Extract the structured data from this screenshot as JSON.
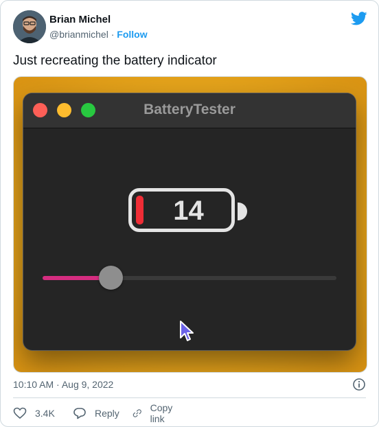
{
  "author": {
    "name": "Brian Michel",
    "handle": "@brianmichel",
    "separator": "·",
    "follow_label": "Follow"
  },
  "tweet": {
    "text": "Just recreating the battery indicator",
    "timestamp": "10:10 AM · Aug 9, 2022"
  },
  "app_window": {
    "title": "BatteryTester",
    "battery_level": "14",
    "slider_fraction": 0.14,
    "colors": {
      "close": "#fe5f57",
      "minimize": "#febc2e",
      "zoom": "#28c840",
      "battery_fill": "#ef2d36",
      "slider_fill": "#d52d80"
    }
  },
  "actions": {
    "like_count": "3.4K",
    "reply_label": "Reply",
    "copy_link_label": "Copy link"
  },
  "icons": {
    "brand": "twitter-bird-icon",
    "info": "info-icon",
    "like": "heart-icon",
    "reply": "speech-bubble-icon",
    "copy_link": "link-icon"
  }
}
